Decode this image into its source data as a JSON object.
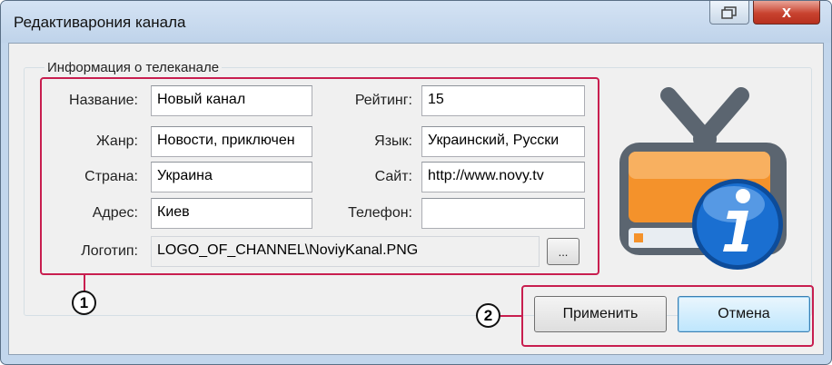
{
  "window": {
    "title": "Редактиварония канала"
  },
  "titlebar_buttons": {
    "close_glyph": "x"
  },
  "group": {
    "legend": "Информация о телеканале",
    "fields": {
      "name": {
        "label": "Название:",
        "value": "Новый канал"
      },
      "rating": {
        "label": "Рейтинг:",
        "value": "15"
      },
      "genre": {
        "label": "Жанр:",
        "value": "Новости, приключен"
      },
      "language": {
        "label": "Язык:",
        "value": "Украинский, Русски"
      },
      "country": {
        "label": "Страна:",
        "value": "Украина"
      },
      "site": {
        "label": "Сайт:",
        "value": "http://www.novy.tv"
      },
      "address": {
        "label": "Адрес:",
        "value": "Киев"
      },
      "phone": {
        "label": "Телефон:",
        "value": ""
      },
      "logo": {
        "label": "Логотип:",
        "value": "LOGO_OF_CHANNEL\\NoviyKanal.PNG"
      }
    },
    "browse_label": "..."
  },
  "buttons": {
    "apply": "Применить",
    "cancel": "Отмена"
  },
  "callouts": {
    "one": "1",
    "two": "2"
  },
  "icons": {
    "restore": "restore-icon",
    "close": "close-icon",
    "tv_info": "tv-info-icon"
  },
  "colors": {
    "highlight": "#c81e4f",
    "tv_body": "#5b6570",
    "tv_screen": "#f4922b",
    "info_badge": "#1a6fd1"
  }
}
